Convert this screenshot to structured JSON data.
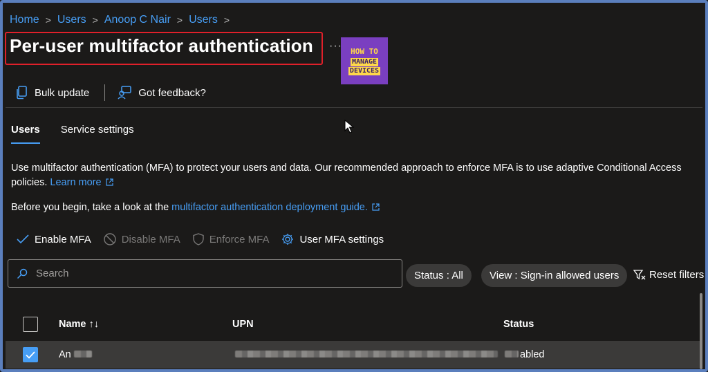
{
  "breadcrumb": [
    "Home",
    "Users",
    "Anoop C Nair",
    "Users"
  ],
  "page": {
    "title": "Per-user multifactor authentication",
    "more": "···"
  },
  "logo": {
    "line1": "HOW TO",
    "line2": "MANAGE",
    "line3": "DEVICES"
  },
  "commands": {
    "bulk_update": "Bulk update",
    "feedback": "Got feedback?"
  },
  "tabs": [
    {
      "label": "Users",
      "active": true
    },
    {
      "label": "Service settings",
      "active": false
    }
  ],
  "description": {
    "text": "Use multifactor authentication (MFA) to protect your users and data. Our recommended approach to enforce MFA is to use adaptive Conditional Access policies.",
    "learn_more": "Learn more",
    "before": "Before you begin, take a look at the",
    "guide_link": "multifactor authentication deployment guide."
  },
  "actions": {
    "enable": "Enable MFA",
    "disable": "Disable MFA",
    "enforce": "Enforce MFA",
    "settings": "User MFA settings"
  },
  "search": {
    "placeholder": "Search"
  },
  "filters": {
    "status": "Status : All",
    "view": "View : Sign-in allowed users",
    "reset": "Reset filters"
  },
  "table": {
    "columns": {
      "name": "Name ↑↓",
      "upn": "UPN",
      "status": "Status"
    },
    "rows": [
      {
        "name": "An",
        "status": "abled",
        "selected": true
      }
    ]
  },
  "colors": {
    "accent": "#479ef5",
    "highlight": "#e0202a",
    "background": "#1b1a19"
  }
}
